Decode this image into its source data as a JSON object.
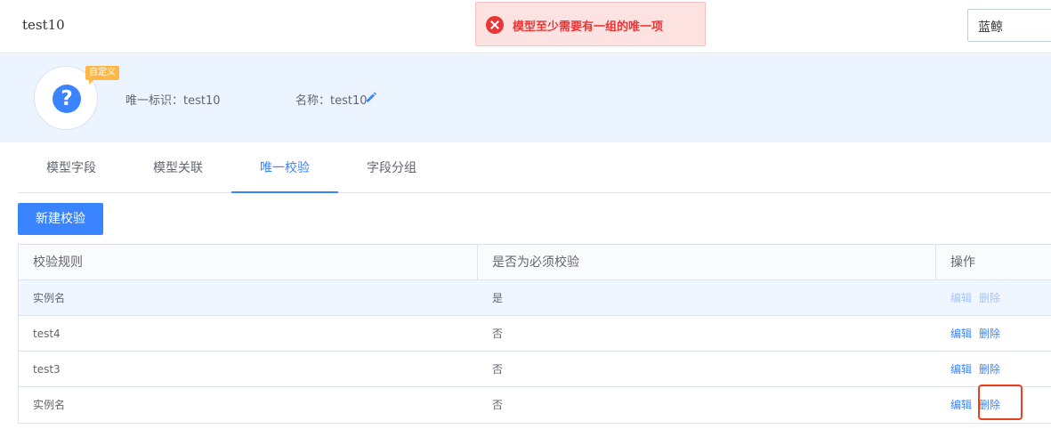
{
  "header": {
    "title": "test10",
    "business_select": "蓝鲸"
  },
  "toast": {
    "message": "模型至少需要有一组的唯一项",
    "icon": "error-circle-icon",
    "color": "#ea3636"
  },
  "model": {
    "icon": "question-circle-icon",
    "badge": "自定义",
    "uid_label": "唯一标识：",
    "uid_value": "test10",
    "name_label": "名称：",
    "name_value": "test10",
    "edit_icon": "pencil-icon"
  },
  "tabs": [
    {
      "label": "模型字段",
      "active": false
    },
    {
      "label": "模型关联",
      "active": false
    },
    {
      "label": "唯一校验",
      "active": true
    },
    {
      "label": "字段分组",
      "active": false
    }
  ],
  "toolbar": {
    "create_label": "新建校验"
  },
  "table": {
    "columns": [
      "校验规则",
      "是否为必须校验",
      "操作"
    ],
    "rows": [
      {
        "rule": "实例名",
        "required": "是",
        "edit": "编辑",
        "delete": "删除",
        "disabled": true
      },
      {
        "rule": "test4",
        "required": "否",
        "edit": "编辑",
        "delete": "删除",
        "disabled": false
      },
      {
        "rule": "test3",
        "required": "否",
        "edit": "编辑",
        "delete": "删除",
        "disabled": false
      },
      {
        "rule": "实例名",
        "required": "否",
        "edit": "编辑",
        "delete": "删除",
        "disabled": false
      }
    ]
  },
  "colors": {
    "accent": "#3a84ff",
    "header_bg": "#ebf4ff",
    "badge": "#ffb848",
    "highlight": "#e8401c"
  }
}
